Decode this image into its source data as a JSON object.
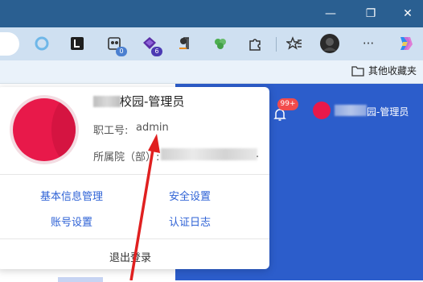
{
  "window": {
    "minimize_glyph": "—",
    "maximize_glyph": "❐",
    "close_glyph": "✕"
  },
  "toolbar": {
    "badge_1": "0",
    "badge_2": "6",
    "more_glyph": "···"
  },
  "favorites_bar": {
    "other_favorites": "其他收藏夹"
  },
  "header": {
    "notice_count": "99+",
    "user_name_suffix": "园-管理员"
  },
  "profile": {
    "school_name": "校园-管理员",
    "employee_no_label": "职工号:",
    "employee_no_value": "admin",
    "department_label": "所属院（部）:",
    "department_trailing": "."
  },
  "menu": {
    "basic_info": "基本信息管理",
    "security": "安全设置",
    "account": "账号设置",
    "auth_log": "认证日志",
    "logout": "退出登录"
  },
  "colors": {
    "accent": "#2e62d6",
    "avatar": "#e8194a",
    "annotation_arrow": "#e02020",
    "panel": "#2c5dcb"
  }
}
